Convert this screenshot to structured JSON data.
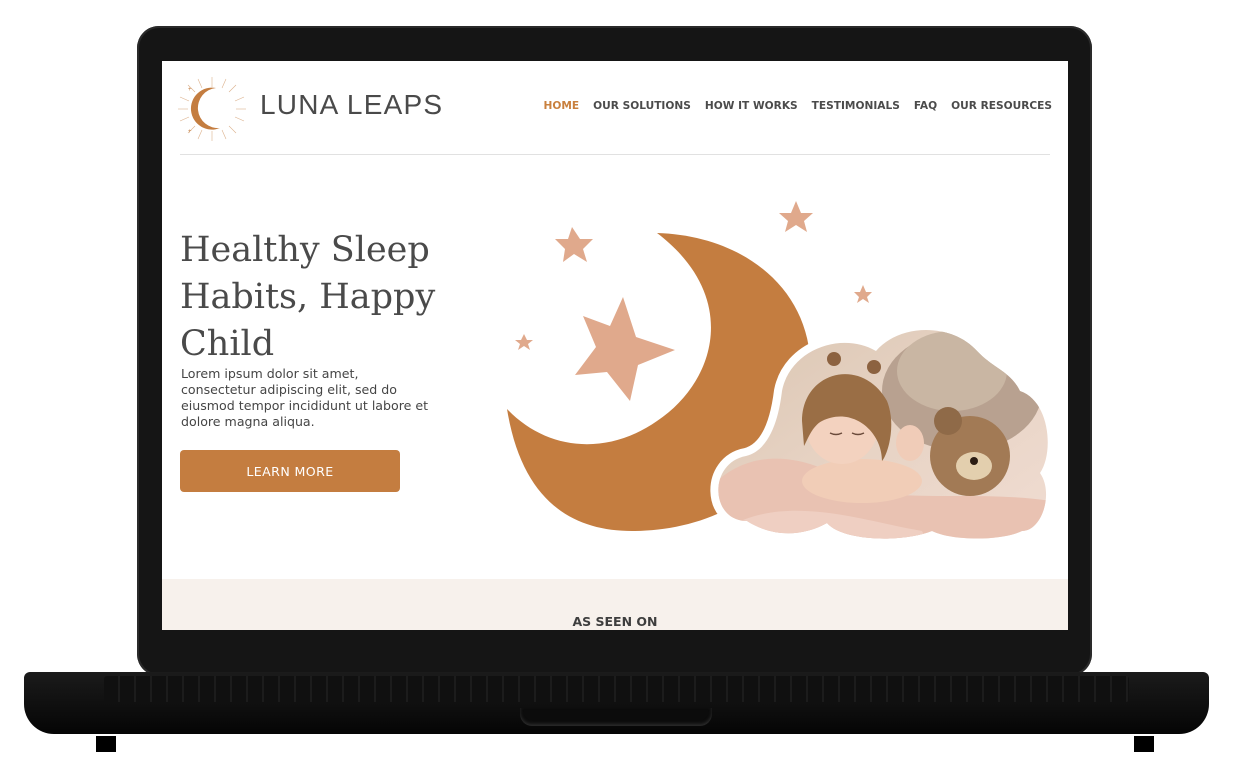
{
  "brand": {
    "name": "LUNA LEAPS",
    "accent": "#c47d40",
    "star_color": "#e0a98c"
  },
  "nav": {
    "items": [
      {
        "label": "HOME",
        "active": true
      },
      {
        "label": "OUR SOLUTIONS",
        "active": false
      },
      {
        "label": "HOW IT WORKS",
        "active": false
      },
      {
        "label": "TESTIMONIALS",
        "active": false
      },
      {
        "label": "FAQ",
        "active": false
      },
      {
        "label": "OUR RESOURCES",
        "active": false
      }
    ]
  },
  "hero": {
    "title": "Healthy Sleep Habits, Happy Child",
    "body": "Lorem ipsum dolor sit amet, consectetur adipiscing elit, sed do eiusmod tempor incididunt ut labore et dolore magna aliqua.",
    "cta_label": "LEARN MORE",
    "image_icon": "sleeping-baby-photo"
  },
  "as_seen_on": {
    "title": "AS SEEN ON"
  }
}
